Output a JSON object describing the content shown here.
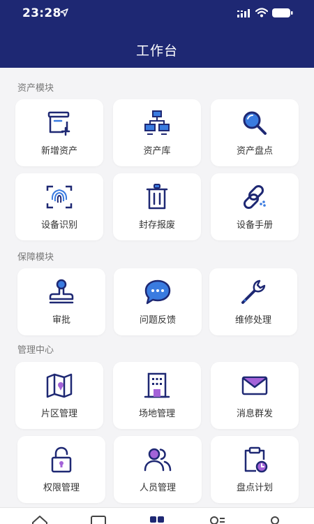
{
  "status": {
    "time": "23:28"
  },
  "header": {
    "title": "工作台"
  },
  "sections": [
    {
      "title": "资产模块",
      "items": [
        {
          "label": "新增资产",
          "icon": "add-box-icon"
        },
        {
          "label": "资产库",
          "icon": "network-icon"
        },
        {
          "label": "资产盘点",
          "icon": "magnifier-icon"
        },
        {
          "label": "设备识别",
          "icon": "scan-icon"
        },
        {
          "label": "封存报废",
          "icon": "trash-icon"
        },
        {
          "label": "设备手册",
          "icon": "link-icon"
        }
      ]
    },
    {
      "title": "保障模块",
      "items": [
        {
          "label": "审批",
          "icon": "stamp-icon"
        },
        {
          "label": "问题反馈",
          "icon": "chat-bubble-icon"
        },
        {
          "label": "维修处理",
          "icon": "wrench-icon"
        }
      ]
    },
    {
      "title": "管理中心",
      "items": [
        {
          "label": "片区管理",
          "icon": "map-icon"
        },
        {
          "label": "场地管理",
          "icon": "building-icon"
        },
        {
          "label": "消息群发",
          "icon": "envelope-icon"
        },
        {
          "label": "权限管理",
          "icon": "padlock-icon"
        },
        {
          "label": "人员管理",
          "icon": "people-icon"
        },
        {
          "label": "盘点计划",
          "icon": "clipboard-clock-icon"
        }
      ]
    }
  ],
  "colors": {
    "header": "#1e2873",
    "icon_navy": "#1e2873",
    "icon_blue": "#3a7be0",
    "icon_purple": "#a463d8",
    "background": "#f4f4f6"
  }
}
